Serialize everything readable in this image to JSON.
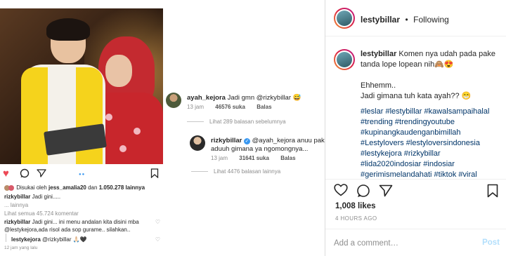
{
  "phone": {
    "liked_prefix": "Disukai oleh",
    "liked_user": "jess_amalia20",
    "liked_mid": "dan",
    "liked_count": "1.050.278 lainnya",
    "caption_user": "rizkybillar",
    "caption_text": "Jadi gini.....",
    "more": "... lainnya",
    "view_all": "Lihat semua 45.724 komentar",
    "comment1_user": "rizkybillar",
    "comment1_text": "Jadi gini... ini menu andalan kita disini mba",
    "comment1_line2": "@lestykejora,ada risol ada sop gurame.. silahkan..",
    "comment2_user": "lestykejora",
    "comment2_text": "@rizkybillar 🙏🏻🖤",
    "time": "12 jam yang lalu"
  },
  "comments": {
    "c1": {
      "user": "ayah_kejora",
      "text": "Jadi gmn @rizkybillar 😅",
      "time": "13 jam",
      "likes": "46576 suka",
      "reply": "Balas"
    },
    "more1": "Lihat 289 balasan sebelumnya",
    "c2": {
      "user": "rizkybillar",
      "text": "@ayah_kejora anuu pak...",
      "text2": "aduuh gimana ya ngomongnya...",
      "time": "13 jam",
      "likes": "31641 suka",
      "reply": "Balas"
    },
    "more2": "Lihat 4476 balasan lainnya"
  },
  "panel": {
    "username": "lestybillar",
    "separator": "•",
    "following": "Following",
    "caption_user": "lestybillar",
    "caption_line1": "Komen nya udah pada pake",
    "caption_line2": "tanda lope lopean nih🙈😍",
    "line3": "Ehhemm..",
    "line4": "Jadi gimana tuh kata ayah?? 😁",
    "tags": [
      "#leslar #lestybillar #kawalsampaihalal",
      "#trending #trendingyoutube",
      "#kupinangkaudenganbimillah",
      "#Lestylovers #lestyloversindonesia",
      "#lestykejora #rizkybillar",
      "#lida2020indosiar #indosiar",
      "#gerimismelandahati #tiktok #viral"
    ],
    "likes": "1,008 likes",
    "ago": "4 HOURS AGO",
    "add_placeholder": "Add a comment…",
    "post": "Post"
  }
}
